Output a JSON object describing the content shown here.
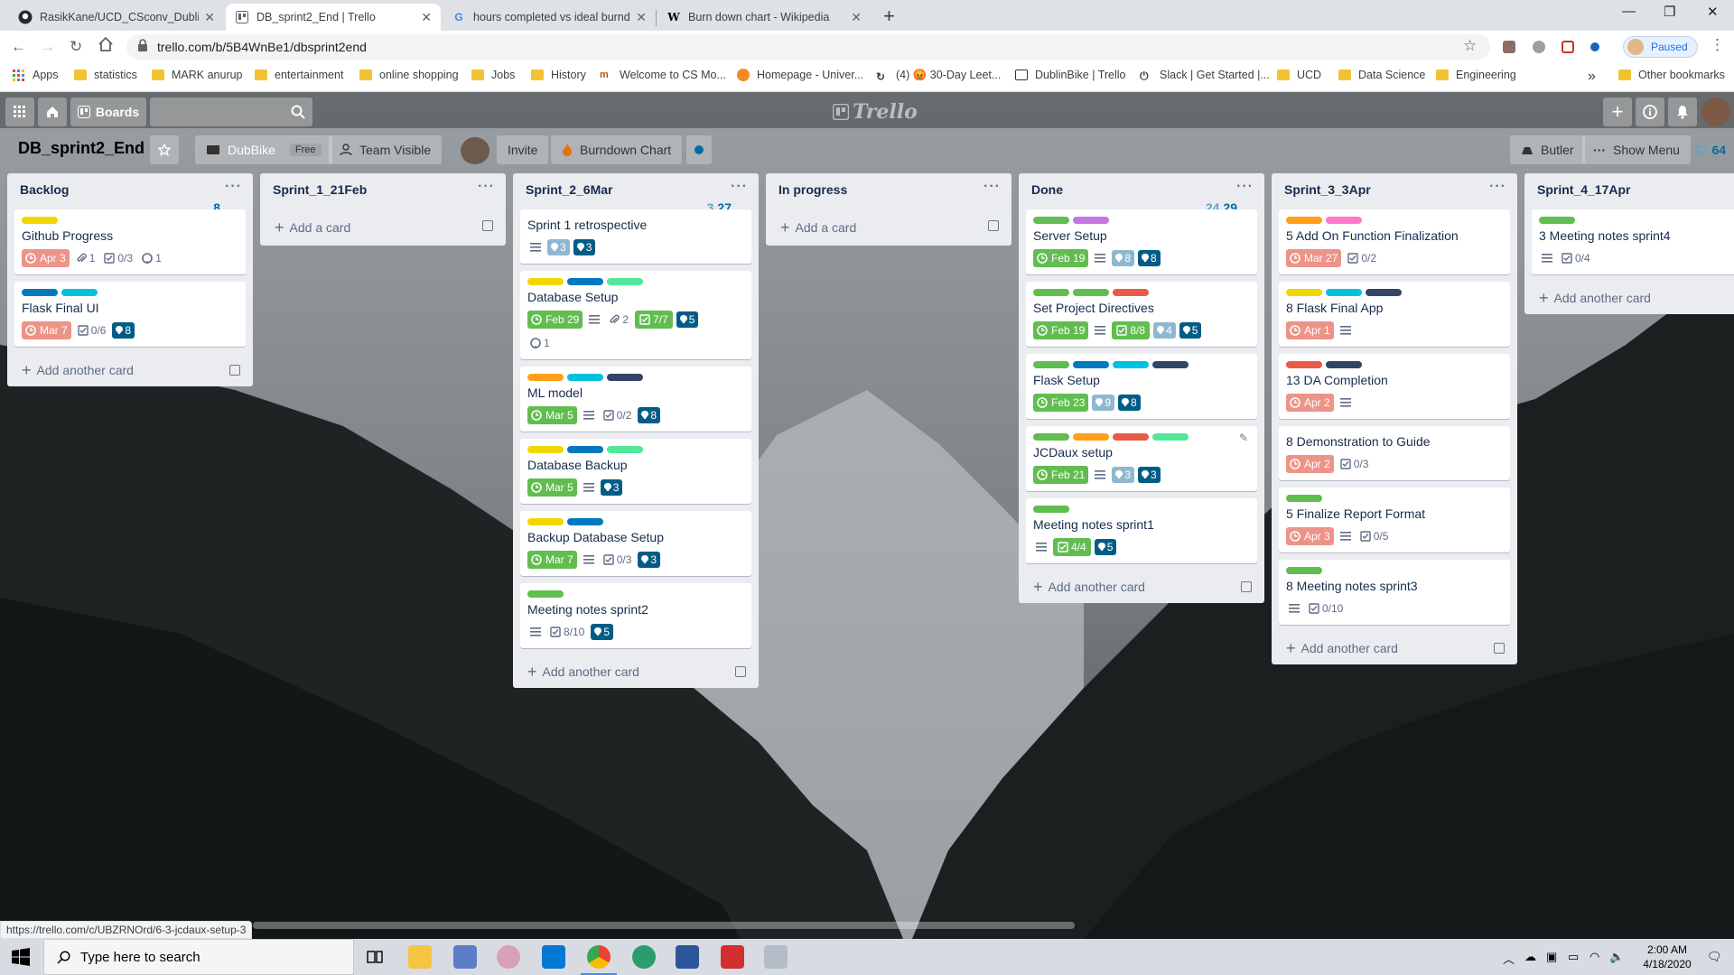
{
  "browser": {
    "tabs": [
      {
        "title": "RasikKane/UCD_CSconv_DublinB",
        "favicon": "github-icon"
      },
      {
        "title": "DB_sprint2_End | Trello",
        "favicon": "trello-icon",
        "active": true
      },
      {
        "title": "hours completed vs ideal burndo",
        "favicon": "google-icon"
      },
      {
        "title": "Burn down chart - Wikipedia",
        "favicon": "wikipedia-icon"
      }
    ],
    "url": "trello.com/b/5B4WnBe1/dbsprint2end",
    "profile_status": "Paused",
    "bookmarks": [
      "Apps",
      "statistics",
      "MARK anurup",
      "entertainment",
      "online shopping",
      "Jobs",
      "History",
      "Welcome to CS Mo...",
      "Homepage - Univer...",
      "(4) 😡 30-Day Leet...",
      "DublinBike | Trello",
      "Slack | Get Started |...",
      "UCD",
      "Data Science",
      "Engineering",
      "»",
      "Other bookmarks"
    ],
    "status_url": "https://trello.com/c/UBZRNOrd/6-3-jcdaux-setup-3"
  },
  "trello": {
    "header": {
      "boards_label": "Boards",
      "logo_text": "Trello"
    },
    "board": {
      "name": "DB_sprint2_End",
      "workspace": "DubBike",
      "workspace_badge": "Free",
      "visibility": "Team Visible",
      "invite": "Invite",
      "powerup": "Burndown Chart",
      "butler": "Butler",
      "show_menu": "Show Menu",
      "hours_estimated": "27",
      "hours_actual": "64"
    },
    "add_card": "Add a card",
    "add_another_card": "Add another card",
    "lists": [
      {
        "name": "Backlog",
        "points_est": "",
        "points_act": "8",
        "cards": [
          {
            "labels": [
              "#f2d600"
            ],
            "title": "Github Progress",
            "due": "Apr 3",
            "due_state": "late",
            "description": false,
            "attachments": "1",
            "checklist": "0/3",
            "github": "1"
          },
          {
            "labels": [
              "#0079bf",
              "#00c2e0"
            ],
            "title": "Flask Final UI",
            "due": "Mar 7",
            "due_state": "late",
            "checklist": "0/6",
            "points_act": "8"
          }
        ],
        "footer": "another"
      },
      {
        "name": "Sprint_1_21Feb",
        "cards": [],
        "footer": "add"
      },
      {
        "name": "Sprint_2_6Mar",
        "points_est": "3",
        "points_act": "27",
        "cards": [
          {
            "labels": [],
            "title": "Sprint 1 retrospective",
            "description": true,
            "points_est": "3",
            "points_act": "3"
          },
          {
            "labels": [
              "#f2d600",
              "#0079bf",
              "#51e898"
            ],
            "title": "Database Setup",
            "due": "Feb 29",
            "due_state": "done",
            "description": true,
            "attachments": "2",
            "checklist": "7/7",
            "checklist_done": true,
            "points_act": "5",
            "github": "1"
          },
          {
            "labels": [
              "#ff9f1a",
              "#00c2e0",
              "#344563"
            ],
            "title": "ML model",
            "due": "Mar 5",
            "due_state": "done",
            "description": true,
            "checklist": "0/2",
            "points_act": "8"
          },
          {
            "labels": [
              "#f2d600",
              "#0079bf",
              "#51e898"
            ],
            "title": "Database Backup",
            "due": "Mar 5",
            "due_state": "done",
            "description": true,
            "points_act": "3"
          },
          {
            "labels": [
              "#f2d600",
              "#0079bf"
            ],
            "title": "Backup Database Setup",
            "due": "Mar 7",
            "due_state": "done",
            "description": true,
            "checklist": "0/3",
            "points_act": "3"
          },
          {
            "labels": [
              "#61bd4f"
            ],
            "title": "Meeting notes sprint2",
            "description": true,
            "checklist": "8/10",
            "points_act": "5"
          }
        ],
        "footer": "another"
      },
      {
        "name": "In progress",
        "cards": [],
        "footer": "add"
      },
      {
        "name": "Done",
        "points_est": "24",
        "points_act": "29",
        "cards": [
          {
            "labels": [
              "#61bd4f",
              "#c377e0"
            ],
            "title": "Server Setup",
            "due": "Feb 19",
            "due_state": "done",
            "description": true,
            "points_est": "8",
            "points_act": "8"
          },
          {
            "labels": [
              "#61bd4f",
              "#61bd4f",
              "#eb5a46"
            ],
            "title": "Set Project Directives",
            "due": "Feb 19",
            "due_state": "done",
            "description": true,
            "checklist": "8/8",
            "checklist_done": true,
            "points_est": "4",
            "points_act": "5"
          },
          {
            "labels": [
              "#61bd4f",
              "#0079bf",
              "#00c2e0",
              "#344563"
            ],
            "title": "Flask Setup",
            "due": "Feb 23",
            "due_state": "done",
            "points_est": "9",
            "points_act": "8"
          },
          {
            "labels": [
              "#61bd4f",
              "#ff9f1a",
              "#eb5a46",
              "#51e898"
            ],
            "title": "JCDaux setup",
            "due": "Feb 21",
            "due_state": "done",
            "description": true,
            "points_est": "3",
            "points_act": "3",
            "edit": true
          },
          {
            "labels": [
              "#61bd4f"
            ],
            "title": "Meeting notes sprint1",
            "description": true,
            "checklist": "4/4",
            "checklist_done": true,
            "points_act": "5"
          }
        ],
        "footer": "another"
      },
      {
        "name": "Sprint_3_3Apr",
        "cards": [
          {
            "labels": [
              "#ff9f1a",
              "#ff78cb"
            ],
            "title": "5 Add On Function Finalization",
            "due": "Mar 27",
            "due_state": "late",
            "checklist": "0/2"
          },
          {
            "labels": [
              "#f2d600",
              "#00c2e0",
              "#344563"
            ],
            "title": "8 Flask Final App",
            "due": "Apr 1",
            "due_state": "late",
            "description": true
          },
          {
            "labels": [
              "#eb5a46",
              "#344563"
            ],
            "title": "13 DA Completion",
            "due": "Apr 2",
            "due_state": "late",
            "description": true
          },
          {
            "labels": [],
            "title": "8 Demonstration to Guide",
            "due": "Apr 2",
            "due_state": "late",
            "checklist": "0/3"
          },
          {
            "labels": [
              "#61bd4f"
            ],
            "title": "5 Finalize Report Format",
            "due": "Apr 3",
            "due_state": "late",
            "description": true,
            "checklist": "0/5"
          },
          {
            "labels": [
              "#61bd4f"
            ],
            "title": "8 Meeting notes sprint3",
            "description": true,
            "checklist": "0/10"
          }
        ],
        "footer": "another"
      },
      {
        "name": "Sprint_4_17Apr",
        "cards": [
          {
            "labels": [
              "#61bd4f"
            ],
            "title": "3 Meeting notes sprint4",
            "description": true,
            "checklist": "0/4"
          }
        ],
        "footer": "another-notmpl"
      }
    ]
  },
  "taskbar": {
    "search_placeholder": "Type here to search",
    "time": "2:00 AM",
    "date": "4/18/2020"
  }
}
